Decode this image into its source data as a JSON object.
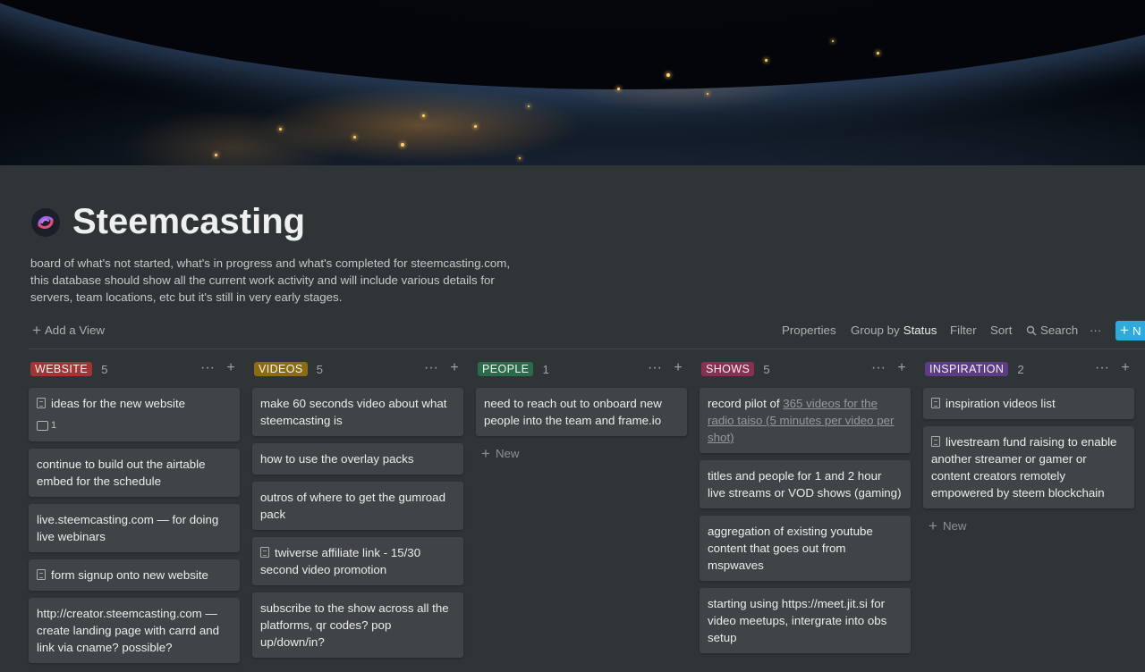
{
  "page": {
    "title": "Steemcasting",
    "description": "board of what's not started, what's in progress and what's completed for steemcasting.com, this database should show all the current work activity and will include various details for servers, team locations, etc but it's still in very early stages."
  },
  "viewbar": {
    "add_view": "Add a View",
    "properties": "Properties",
    "group_by_prefix": "Group by",
    "group_by_value": "Status",
    "filter": "Filter",
    "sort": "Sort",
    "search": "Search",
    "more": "···",
    "new": "N"
  },
  "columns": [
    {
      "label": "WEBSITE",
      "count": "5",
      "color": "#a13434",
      "cards": [
        {
          "text": "ideas for the new website",
          "has_doc": true,
          "comments": "1"
        },
        {
          "text": "continue to build out the airtable embed for the schedule"
        },
        {
          "text": "live.steemcasting.com — for doing live webinars"
        },
        {
          "text": "form signup onto new website",
          "has_doc": true
        },
        {
          "text": "http://creator.steemcasting.com — create landing page with carrd and link via cname? possible?"
        }
      ]
    },
    {
      "label": "VIDEOS",
      "count": "5",
      "color": "#8c6c12",
      "cards": [
        {
          "text": "make 60 seconds video about what steemcasting is"
        },
        {
          "text": "how to use the overlay packs"
        },
        {
          "text": "outros of where to get the gumroad pack"
        },
        {
          "text": "twiverse affiliate link - 15/30 second video promotion",
          "has_doc": true
        },
        {
          "text": "subscribe to the show across all the platforms, qr codes? pop up/down/in?"
        }
      ]
    },
    {
      "label": "PEOPLE",
      "count": "1",
      "color": "#2b6a4a",
      "cards": [
        {
          "text": "need to reach out to onboard new people into the team and frame.io"
        }
      ],
      "new_label": "New"
    },
    {
      "label": "SHOWS",
      "count": "5",
      "color": "#8a2f52",
      "cards": [
        {
          "text": "record pilot of",
          "link": "365 videos for the radio taiso (5 minutes per video per shot)"
        },
        {
          "text": "titles and people for 1 and 2 hour live streams or VOD shows (gaming)"
        },
        {
          "text": "aggregation of existing youtube content that goes out from mspwaves"
        },
        {
          "text": "starting using https://meet.jit.si for video meetups, intergrate into obs setup"
        }
      ]
    },
    {
      "label": "INSPIRATION",
      "count": "2",
      "color": "#5b3c85",
      "cards": [
        {
          "text": "inspiration videos list",
          "has_doc": true
        },
        {
          "text": "livestream fund raising to enable another streamer or gamer or content creators remotely empowered by steem blockchain",
          "has_doc": true
        }
      ],
      "new_label": "New"
    }
  ]
}
